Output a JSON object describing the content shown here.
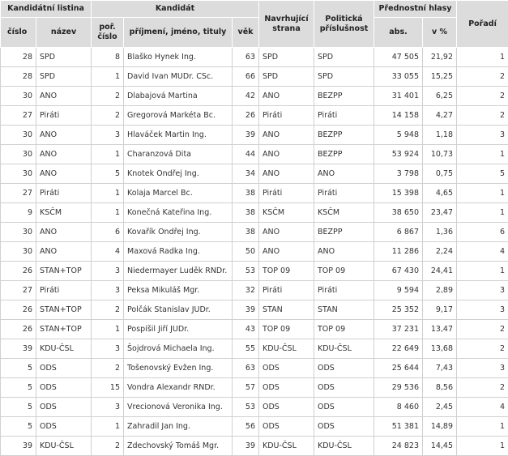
{
  "headers": {
    "kandidatni_listina": "Kandidátní listina",
    "kandidat": "Kandidát",
    "navrhujici_strana": "Navrhující strana",
    "politicka_prislusnost": "Politická příslušnost",
    "prednostni_hlasy": "Přednostní hlasy",
    "poradi": "Pořadí",
    "cislo": "číslo",
    "nazev": "název",
    "por_cislo": "poř. číslo",
    "jmeno": "příjmení, jméno, tituly",
    "vek": "věk",
    "abs": "abs.",
    "v_procentech": "v %"
  },
  "rows": [
    {
      "cislo": "28",
      "nazev": "SPD",
      "por": "8",
      "jmeno": "Blaško Hynek Ing.",
      "vek": "63",
      "strana": "SPD",
      "prislusnost": "SPD",
      "abs": "47 505",
      "pct": "21,92",
      "poradi": "1"
    },
    {
      "cislo": "28",
      "nazev": "SPD",
      "por": "1",
      "jmeno": "David Ivan MUDr. CSc.",
      "vek": "66",
      "strana": "SPD",
      "prislusnost": "SPD",
      "abs": "33 055",
      "pct": "15,25",
      "poradi": "2"
    },
    {
      "cislo": "30",
      "nazev": "ANO",
      "por": "2",
      "jmeno": "Dlabajová Martina",
      "vek": "42",
      "strana": "ANO",
      "prislusnost": "BEZPP",
      "abs": "31 401",
      "pct": "6,25",
      "poradi": "2"
    },
    {
      "cislo": "27",
      "nazev": "Piráti",
      "por": "2",
      "jmeno": "Gregorová Markéta Bc.",
      "vek": "26",
      "strana": "Piráti",
      "prislusnost": "Piráti",
      "abs": "14 158",
      "pct": "4,27",
      "poradi": "2"
    },
    {
      "cislo": "30",
      "nazev": "ANO",
      "por": "3",
      "jmeno": "Hlaváček Martin Ing.",
      "vek": "39",
      "strana": "ANO",
      "prislusnost": "BEZPP",
      "abs": "5 948",
      "pct": "1,18",
      "poradi": "3"
    },
    {
      "cislo": "30",
      "nazev": "ANO",
      "por": "1",
      "jmeno": "Charanzová Dita",
      "vek": "44",
      "strana": "ANO",
      "prislusnost": "BEZPP",
      "abs": "53 924",
      "pct": "10,73",
      "poradi": "1"
    },
    {
      "cislo": "30",
      "nazev": "ANO",
      "por": "5",
      "jmeno": "Knotek Ondřej Ing.",
      "vek": "34",
      "strana": "ANO",
      "prislusnost": "ANO",
      "abs": "3 798",
      "pct": "0,75",
      "poradi": "5"
    },
    {
      "cislo": "27",
      "nazev": "Piráti",
      "por": "1",
      "jmeno": "Kolaja Marcel Bc.",
      "vek": "38",
      "strana": "Piráti",
      "prislusnost": "Piráti",
      "abs": "15 398",
      "pct": "4,65",
      "poradi": "1"
    },
    {
      "cislo": "9",
      "nazev": "KSČM",
      "por": "1",
      "jmeno": "Konečná Kateřina Ing.",
      "vek": "38",
      "strana": "KSČM",
      "prislusnost": "KSČM",
      "abs": "38 650",
      "pct": "23,47",
      "poradi": "1"
    },
    {
      "cislo": "30",
      "nazev": "ANO",
      "por": "6",
      "jmeno": "Kovařík Ondřej Ing.",
      "vek": "38",
      "strana": "ANO",
      "prislusnost": "BEZPP",
      "abs": "6 867",
      "pct": "1,36",
      "poradi": "6"
    },
    {
      "cislo": "30",
      "nazev": "ANO",
      "por": "4",
      "jmeno": "Maxová Radka Ing.",
      "vek": "50",
      "strana": "ANO",
      "prislusnost": "ANO",
      "abs": "11 286",
      "pct": "2,24",
      "poradi": "4"
    },
    {
      "cislo": "26",
      "nazev": "STAN+TOP",
      "por": "3",
      "jmeno": "Niedermayer Luděk RNDr.",
      "vek": "53",
      "strana": "TOP 09",
      "prislusnost": "TOP 09",
      "abs": "67 430",
      "pct": "24,41",
      "poradi": "1"
    },
    {
      "cislo": "27",
      "nazev": "Piráti",
      "por": "3",
      "jmeno": "Peksa Mikuláš Mgr.",
      "vek": "32",
      "strana": "Piráti",
      "prislusnost": "Piráti",
      "abs": "9 594",
      "pct": "2,89",
      "poradi": "3"
    },
    {
      "cislo": "26",
      "nazev": "STAN+TOP",
      "por": "2",
      "jmeno": "Polčák Stanislav JUDr.",
      "vek": "39",
      "strana": "STAN",
      "prislusnost": "STAN",
      "abs": "25 352",
      "pct": "9,17",
      "poradi": "3"
    },
    {
      "cislo": "26",
      "nazev": "STAN+TOP",
      "por": "1",
      "jmeno": "Pospíšil Jiří JUDr.",
      "vek": "43",
      "strana": "TOP 09",
      "prislusnost": "TOP 09",
      "abs": "37 231",
      "pct": "13,47",
      "poradi": "2"
    },
    {
      "cislo": "39",
      "nazev": "KDU-ČSL",
      "por": "3",
      "jmeno": "Šojdrová Michaela Ing.",
      "vek": "55",
      "strana": "KDU-ČSL",
      "prislusnost": "KDU-ČSL",
      "abs": "22 649",
      "pct": "13,68",
      "poradi": "2"
    },
    {
      "cislo": "5",
      "nazev": "ODS",
      "por": "2",
      "jmeno": "Tošenovský Evžen Ing.",
      "vek": "63",
      "strana": "ODS",
      "prislusnost": "ODS",
      "abs": "25 644",
      "pct": "7,43",
      "poradi": "3"
    },
    {
      "cislo": "5",
      "nazev": "ODS",
      "por": "15",
      "jmeno": "Vondra Alexandr RNDr.",
      "vek": "57",
      "strana": "ODS",
      "prislusnost": "ODS",
      "abs": "29 536",
      "pct": "8,56",
      "poradi": "2"
    },
    {
      "cislo": "5",
      "nazev": "ODS",
      "por": "3",
      "jmeno": "Vrecionová Veronika Ing.",
      "vek": "53",
      "strana": "ODS",
      "prislusnost": "ODS",
      "abs": "8 460",
      "pct": "2,45",
      "poradi": "4"
    },
    {
      "cislo": "5",
      "nazev": "ODS",
      "por": "1",
      "jmeno": "Zahradil Jan Ing.",
      "vek": "56",
      "strana": "ODS",
      "prislusnost": "ODS",
      "abs": "51 381",
      "pct": "14,89",
      "poradi": "1"
    },
    {
      "cislo": "39",
      "nazev": "KDU-ČSL",
      "por": "2",
      "jmeno": "Zdechovský Tomáš Mgr.",
      "vek": "39",
      "strana": "KDU-ČSL",
      "prislusnost": "KDU-ČSL",
      "abs": "24 823",
      "pct": "14,45",
      "poradi": "1"
    }
  ]
}
